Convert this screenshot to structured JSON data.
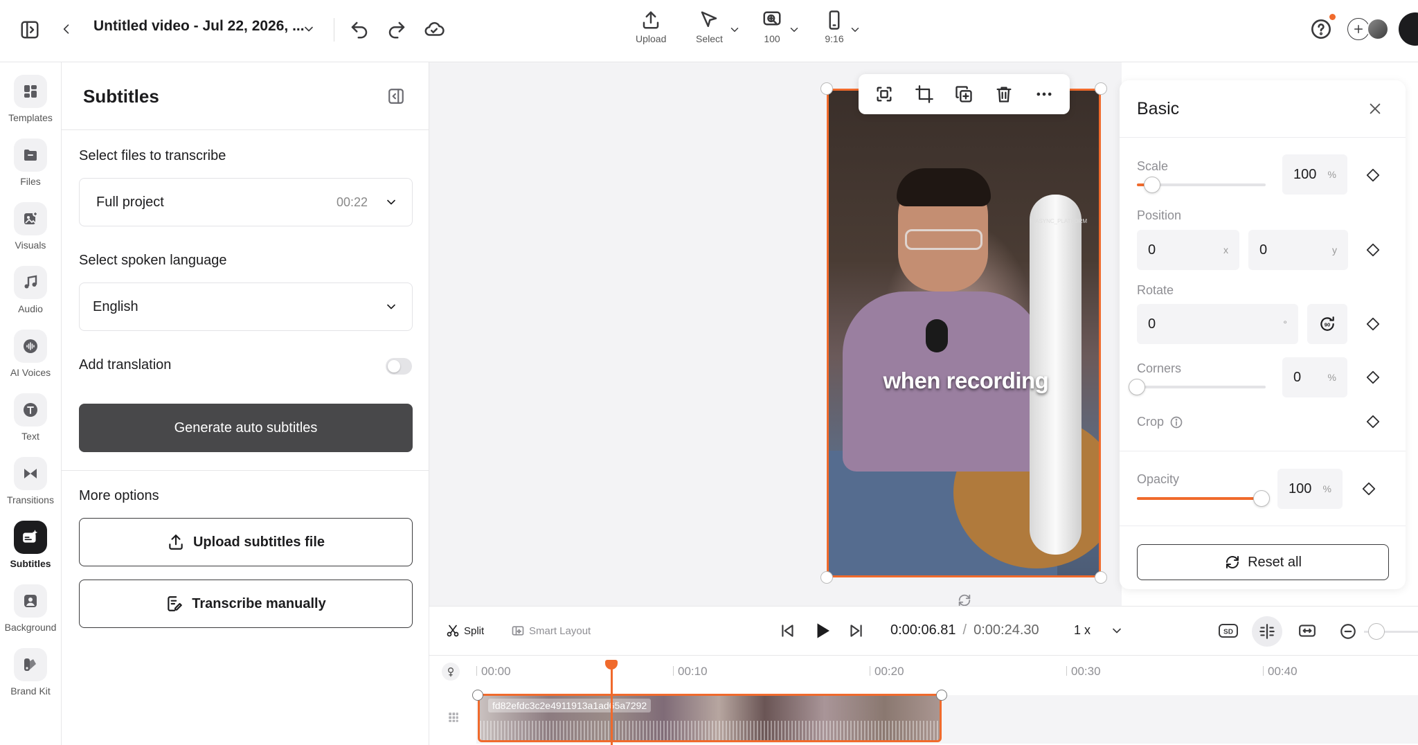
{
  "header": {
    "title": "Untitled video - Jul 22, 2026, ...",
    "tools": [
      {
        "label": "Upload"
      },
      {
        "label": "Select"
      },
      {
        "label": "100"
      },
      {
        "label": "9:16"
      }
    ]
  },
  "rail": {
    "items": [
      {
        "label": "Templates",
        "icon": "templates-icon"
      },
      {
        "label": "Files",
        "icon": "folder-icon"
      },
      {
        "label": "Visuals",
        "icon": "image-plus-icon"
      },
      {
        "label": "Audio",
        "icon": "music-note-icon"
      },
      {
        "label": "AI Voices",
        "icon": "voice-wave-icon"
      },
      {
        "label": "Text",
        "icon": "text-icon"
      },
      {
        "label": "Transitions",
        "icon": "bowtie-icon"
      },
      {
        "label": "Subtitles",
        "icon": "subtitles-icon",
        "active": true
      },
      {
        "label": "Background",
        "icon": "background-icon"
      },
      {
        "label": "Brand Kit",
        "icon": "brand-kit-icon"
      }
    ]
  },
  "panel": {
    "title": "Subtitles",
    "files_label": "Select files to transcribe",
    "files_value": "Full project",
    "files_duration": "00:22",
    "language_label": "Select spoken language",
    "language_value": "English",
    "translation_label": "Add translation",
    "translation_on": false,
    "generate_label": "Generate auto subtitles",
    "more_options_label": "More options",
    "upload_label": "Upload subtitles file",
    "transcribe_label": "Transcribe manually"
  },
  "canvas": {
    "caption": "when recording",
    "watermark": "@ASYNC_PLATFORM"
  },
  "basic": {
    "title": "Basic",
    "scale_label": "Scale",
    "scale_value": "100",
    "scale_unit": "%",
    "scale_level": 0.12,
    "position_label": "Position",
    "position_x": "0",
    "position_x_unit": "x",
    "position_y": "0",
    "position_y_unit": "y",
    "rotate_label": "Rotate",
    "rotate_value": "0",
    "rotate_unit": "°",
    "corners_label": "Corners",
    "corners_value": "0",
    "corners_unit": "%",
    "corners_level": 0,
    "crop_label": "Crop",
    "opacity_label": "Opacity",
    "opacity_value": "100",
    "opacity_unit": "%",
    "opacity_level": 1.0,
    "reset_label": "Reset all"
  },
  "playback": {
    "split_label": "Split",
    "smart_layout_label": "Smart Layout",
    "current_time": "0:00:06.81",
    "separator": "/",
    "total_time": "0:00:24.30",
    "speed": "1 x"
  },
  "timeline": {
    "ticks": [
      "00:00",
      "00:10",
      "00:20",
      "00:30",
      "00:40"
    ],
    "clip_name": "fd82efdc3c2e4911913a1ad65a7292",
    "playhead_time_sec": 6.81
  },
  "colors": {
    "accent": "#f06a2c",
    "primary_button": "#48484a"
  }
}
